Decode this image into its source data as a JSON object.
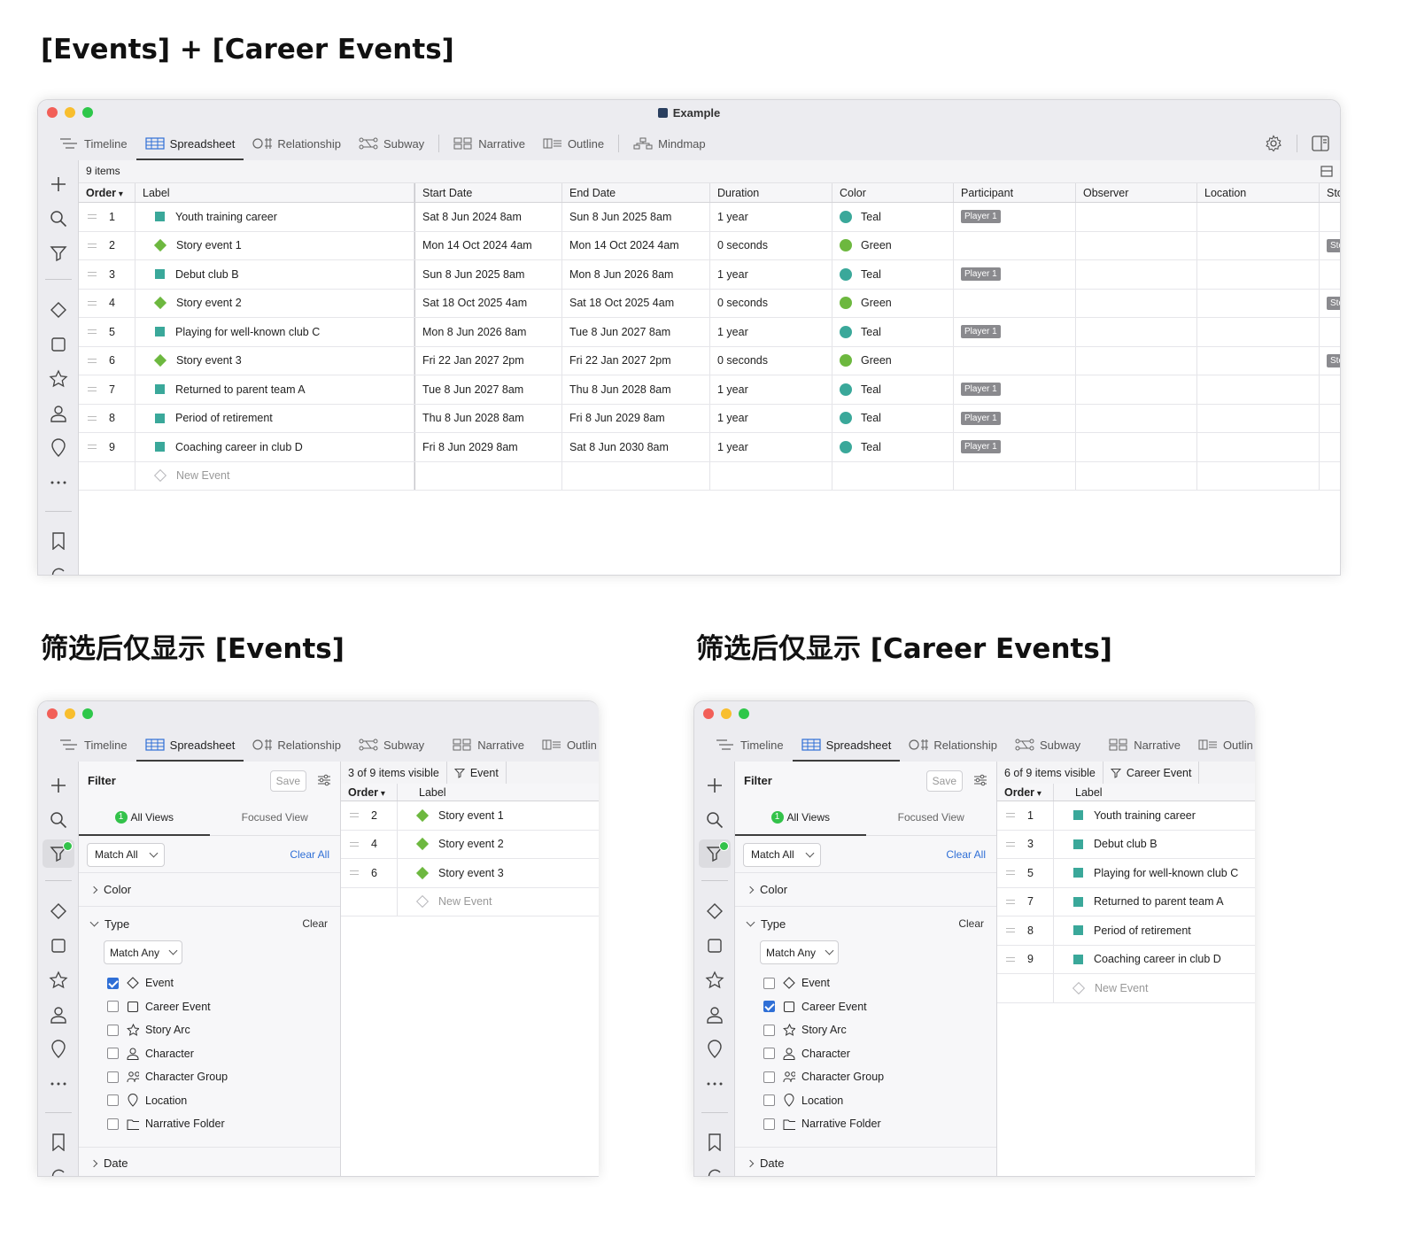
{
  "headings": {
    "top": "[Events] + [Career Events]",
    "bottom_left": "筛选后仅显示 [Events]",
    "bottom_right": "筛选后仅显示 [Career Events]"
  },
  "window": {
    "title": "Example"
  },
  "tabs": [
    "Timeline",
    "Spreadsheet",
    "Relationship",
    "Subway",
    "Narrative",
    "Outline",
    "Mindmap"
  ],
  "tabs_clipped": {
    "outline": "Outlin"
  },
  "main_table": {
    "count": "9 items",
    "columns": [
      "Order",
      "Label",
      "Start Date",
      "End Date",
      "Duration",
      "Color",
      "Participant",
      "Observer",
      "Location",
      "Sto"
    ],
    "rows": [
      {
        "order": "1",
        "type": "career",
        "label": "Youth training career",
        "start": "Sat 8 Jun 2024 8am",
        "end": "Sun 8 Jun 2025 8am",
        "duration": "1 year",
        "color": "Teal",
        "participant": "Player 1",
        "extra": ""
      },
      {
        "order": "2",
        "type": "event",
        "label": "Story event 1",
        "start": "Mon 14 Oct 2024 4am",
        "end": "Mon 14 Oct 2024 4am",
        "duration": "0 seconds",
        "color": "Green",
        "participant": "",
        "extra": "Sto"
      },
      {
        "order": "3",
        "type": "career",
        "label": "Debut club B",
        "start": "Sun 8 Jun 2025 8am",
        "end": "Mon 8 Jun 2026 8am",
        "duration": "1 year",
        "color": "Teal",
        "participant": "Player 1",
        "extra": ""
      },
      {
        "order": "4",
        "type": "event",
        "label": "Story event 2",
        "start": "Sat 18 Oct 2025 4am",
        "end": "Sat 18 Oct 2025 4am",
        "duration": "0 seconds",
        "color": "Green",
        "participant": "",
        "extra": "Sto"
      },
      {
        "order": "5",
        "type": "career",
        "label": "Playing for well-known club C",
        "start": "Mon 8 Jun 2026 8am",
        "end": "Tue 8 Jun 2027 8am",
        "duration": "1 year",
        "color": "Teal",
        "participant": "Player 1",
        "extra": ""
      },
      {
        "order": "6",
        "type": "event",
        "label": "Story event 3",
        "start": "Fri 22 Jan 2027 2pm",
        "end": "Fri 22 Jan 2027 2pm",
        "duration": "0 seconds",
        "color": "Green",
        "participant": "",
        "extra": "Sto"
      },
      {
        "order": "7",
        "type": "career",
        "label": "Returned to parent team A",
        "start": "Tue 8 Jun 2027 8am",
        "end": "Thu 8 Jun 2028 8am",
        "duration": "1 year",
        "color": "Teal",
        "participant": "Player 1",
        "extra": ""
      },
      {
        "order": "8",
        "type": "career",
        "label": "Period of retirement",
        "start": "Thu 8 Jun 2028 8am",
        "end": "Fri 8 Jun 2029 8am",
        "duration": "1 year",
        "color": "Teal",
        "participant": "Player 1",
        "extra": ""
      },
      {
        "order": "9",
        "type": "career",
        "label": "Coaching career in club D",
        "start": "Fri 8 Jun 2029 8am",
        "end": "Sat 8 Jun 2030 8am",
        "duration": "1 year",
        "color": "Teal",
        "participant": "Player 1",
        "extra": ""
      }
    ],
    "new_row": "New Event"
  },
  "colors": {
    "teal": "#3aa89a",
    "green": "#6db83f",
    "accent": "#2f6fd6",
    "filter_dot": "#33c24a"
  },
  "filter_common": {
    "title": "Filter",
    "save": "Save",
    "all_views_badge": "1",
    "all_views": "All Views",
    "focused_view": "Focused View",
    "match_all": "Match All",
    "clear_all": "Clear All",
    "color_section": "Color",
    "type_section": "Type",
    "type_clear": "Clear",
    "match_any": "Match Any",
    "types": [
      "Event",
      "Career Event",
      "Story Arc",
      "Character",
      "Character Group",
      "Location",
      "Narrative Folder"
    ],
    "date_section": "Date",
    "order_header": "Order",
    "label_header": "Label",
    "new_row": "New Event"
  },
  "filter_events": {
    "visible": "3 of 9 items visible",
    "chip": "Event",
    "checked": "Event",
    "rows": [
      {
        "order": "2",
        "label": "Story event 1"
      },
      {
        "order": "4",
        "label": "Story event 2"
      },
      {
        "order": "6",
        "label": "Story event 3"
      }
    ]
  },
  "filter_career": {
    "visible": "6 of 9 items visible",
    "chip": "Career Event",
    "checked": "Career Event",
    "rows": [
      {
        "order": "1",
        "label": "Youth training career"
      },
      {
        "order": "3",
        "label": "Debut club B"
      },
      {
        "order": "5",
        "label": "Playing for well-known club C"
      },
      {
        "order": "7",
        "label": "Returned to parent team A"
      },
      {
        "order": "8",
        "label": "Period of retirement"
      },
      {
        "order": "9",
        "label": "Coaching career in club D"
      }
    ]
  }
}
